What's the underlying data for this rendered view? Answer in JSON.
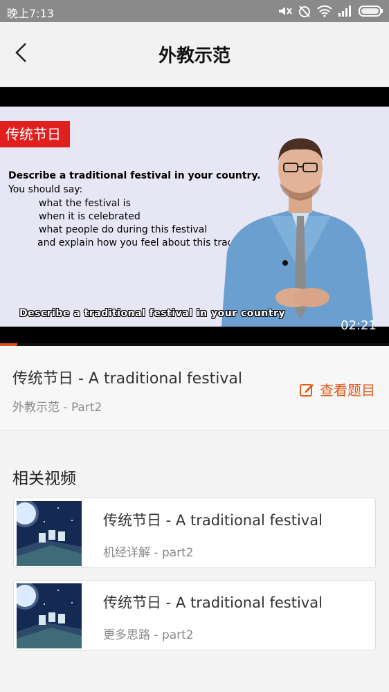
{
  "status_bar": {
    "time": "晚上7:13",
    "icons": [
      "mute-icon",
      "alarm-off-icon",
      "wifi-icon",
      "signal-icon",
      "battery-icon"
    ]
  },
  "nav": {
    "back_icon": "chevron-left-icon",
    "title": "外教示范"
  },
  "video": {
    "tag": "传统节日",
    "question": "Describe a traditional festival in your country.",
    "you_should_say": "You should say:",
    "prompts": [
      "what the festival is",
      "when it is celebrated",
      "what people do during this festival",
      "and explain how you feel about this tradi"
    ],
    "caption": "Describe a traditional festival in your country",
    "time": "02:21",
    "progress": 0.045
  },
  "info": {
    "title": "传统节日 - A traditional festival",
    "subtitle": "外教示范 - Part2",
    "view_questions": "查看题目",
    "view_questions_icon": "edit-icon"
  },
  "related": {
    "title": "相关视频",
    "items": [
      {
        "title": "传统节日 - A traditional festival",
        "subtitle": "机经详解 - part2"
      },
      {
        "title": "传统节日 - A traditional festival",
        "subtitle": "更多思路 - part2"
      }
    ]
  },
  "colors": {
    "accent": "#e25a1c",
    "video_tag_bg": "#e0201e",
    "status_bar_bg": "#8a8a8a"
  }
}
